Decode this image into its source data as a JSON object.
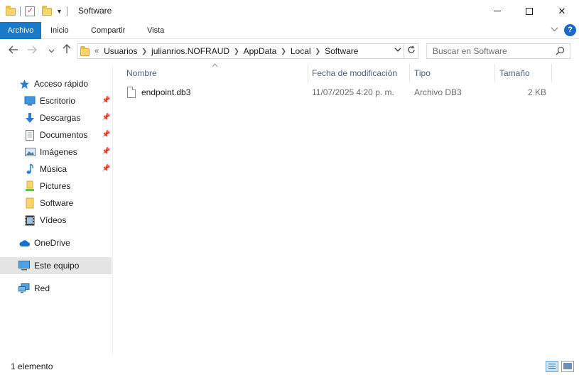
{
  "window": {
    "title": "Software",
    "controls": {
      "minimize": "minimize",
      "maximize": "maximize",
      "close": "✕"
    }
  },
  "ribbon": {
    "tabs": [
      "Archivo",
      "Inicio",
      "Compartir",
      "Vista"
    ],
    "help_label": "?",
    "accent": "#1979ca"
  },
  "nav": {
    "breadcrumb": [
      "Usuarios",
      "julianrios.NOFRAUD",
      "AppData",
      "Local",
      "Software"
    ],
    "overflow_marker": "«",
    "search_placeholder": "Buscar en Software"
  },
  "sidebar": {
    "items": [
      {
        "label": "Acceso rápido",
        "icon": "star-icon"
      },
      {
        "label": "Escritorio",
        "icon": "desktop-icon",
        "pinned": true
      },
      {
        "label": "Descargas",
        "icon": "download-icon",
        "pinned": true
      },
      {
        "label": "Documentos",
        "icon": "document-icon",
        "pinned": true
      },
      {
        "label": "Imágenes",
        "icon": "image-icon",
        "pinned": true
      },
      {
        "label": "Música",
        "icon": "music-icon",
        "pinned": true
      },
      {
        "label": "Pictures",
        "icon": "pictures-folder-icon"
      },
      {
        "label": "Software",
        "icon": "folder-icon"
      },
      {
        "label": "Vídeos",
        "icon": "video-icon"
      },
      {
        "label": "OneDrive",
        "icon": "cloud-icon"
      },
      {
        "label": "Este equipo",
        "icon": "computer-icon",
        "selected": true
      },
      {
        "label": "Red",
        "icon": "network-icon"
      }
    ]
  },
  "file_list": {
    "columns": [
      "Nombre",
      "Fecha de modificación",
      "Tipo",
      "Tamaño"
    ],
    "rows": [
      {
        "name": "endpoint.db3",
        "modified": "11/07/2025 4:20 p. m.",
        "type": "Archivo DB3",
        "size": "2 KB"
      }
    ]
  },
  "status": {
    "item_count": "1 elemento"
  }
}
